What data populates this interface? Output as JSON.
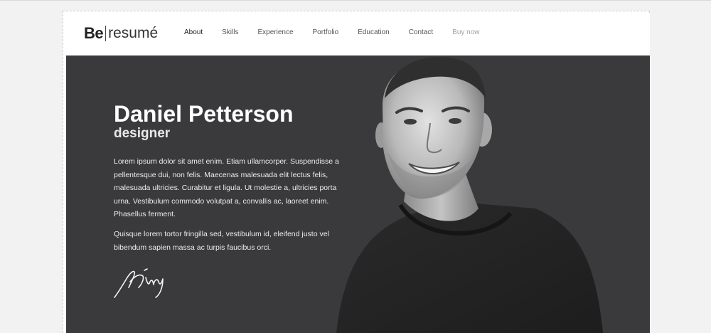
{
  "logo": {
    "brand": "Be",
    "word": "resumé"
  },
  "nav": {
    "items": [
      {
        "label": "About"
      },
      {
        "label": "Skills"
      },
      {
        "label": "Experience"
      },
      {
        "label": "Portfolio"
      },
      {
        "label": "Education"
      },
      {
        "label": "Contact"
      },
      {
        "label": "Buy now"
      }
    ],
    "active": "About"
  },
  "hero": {
    "name": "Daniel Petterson",
    "role": "designer",
    "paragraph1": "Lorem ipsum dolor sit amet enim. Etiam ullamcorper. Suspendisse a pellentesque dui, non felis. Maecenas malesuada elit lectus felis, malesuada ultricies. Curabitur et ligula. Ut molestie a, ultricies porta urna. Vestibulum commodo volutpat a, convallis ac, laoreet enim. Phasellus ferment.",
    "paragraph2": "Quisque lorem tortor fringilla sed, vestibulum id, eleifend justo vel bibendum sapien massa ac turpis faucibus orci."
  },
  "colors": {
    "hero_background": "#3a3a3c",
    "nav_text": "#555555",
    "nav_buy": "#a0a0a0"
  },
  "icons": {
    "signature": "signature-icon",
    "portrait": "portrait-photo"
  }
}
